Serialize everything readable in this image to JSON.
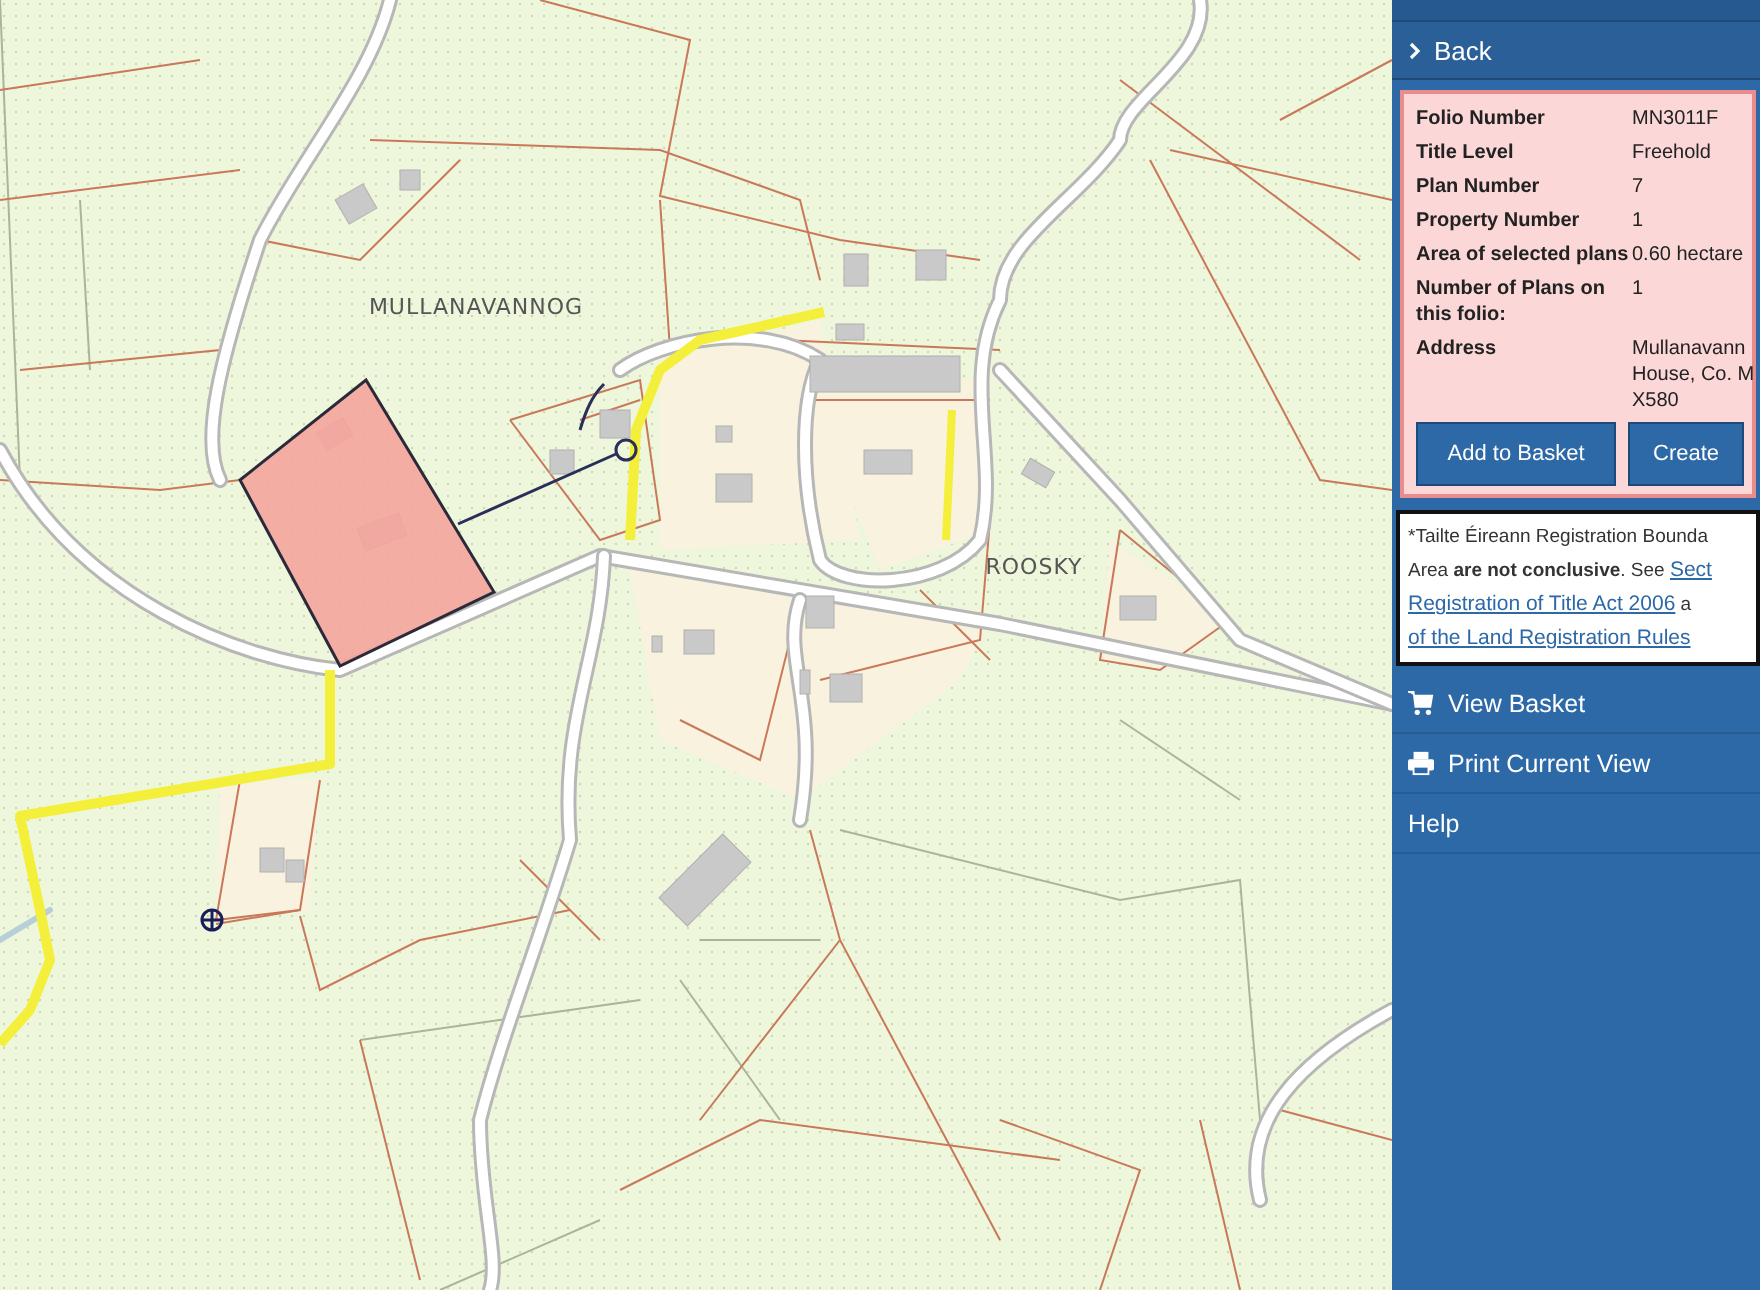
{
  "map": {
    "place_labels": [
      {
        "text": "MULLANAVANNOG",
        "kind": "townland"
      },
      {
        "text": "ROOSKY",
        "kind": "townland"
      }
    ]
  },
  "sidebar": {
    "back": {
      "label": "Back"
    },
    "details": [
      {
        "label": "Folio Number",
        "value": "MN3011F"
      },
      {
        "label": "Title Level",
        "value": "Freehold"
      },
      {
        "label": "Plan Number",
        "value": "7"
      },
      {
        "label": "Property Number",
        "value": "1"
      },
      {
        "label": "Area of selected plans",
        "value": "0.60 hectare"
      },
      {
        "label": "Number of Plans on this folio:",
        "value": "1"
      },
      {
        "label": "Address",
        "value": "Mullanavann House, Co. M X580"
      }
    ],
    "buttons": [
      "Add to Basket",
      "Create"
    ],
    "disclaimer": [
      [
        {
          "kind": "text",
          "text": "*Tailte Éireann Registration Bounda"
        }
      ],
      [
        {
          "kind": "text",
          "text": "Area **are not conclusive**. See "
        },
        {
          "kind": "link",
          "text": "Sect"
        }
      ],
      [
        {
          "kind": "link",
          "text": "Registration of Title Act 2006"
        },
        {
          "kind": "text",
          "text": " a"
        }
      ],
      [
        {
          "kind": "link",
          "text": "of the Land Registration Rules"
        }
      ]
    ],
    "menu": [
      {
        "label": "View Basket",
        "kind": "cart"
      },
      {
        "label": "Print Current View",
        "kind": "print"
      },
      {
        "label": "Help",
        "kind": "plain"
      }
    ]
  }
}
